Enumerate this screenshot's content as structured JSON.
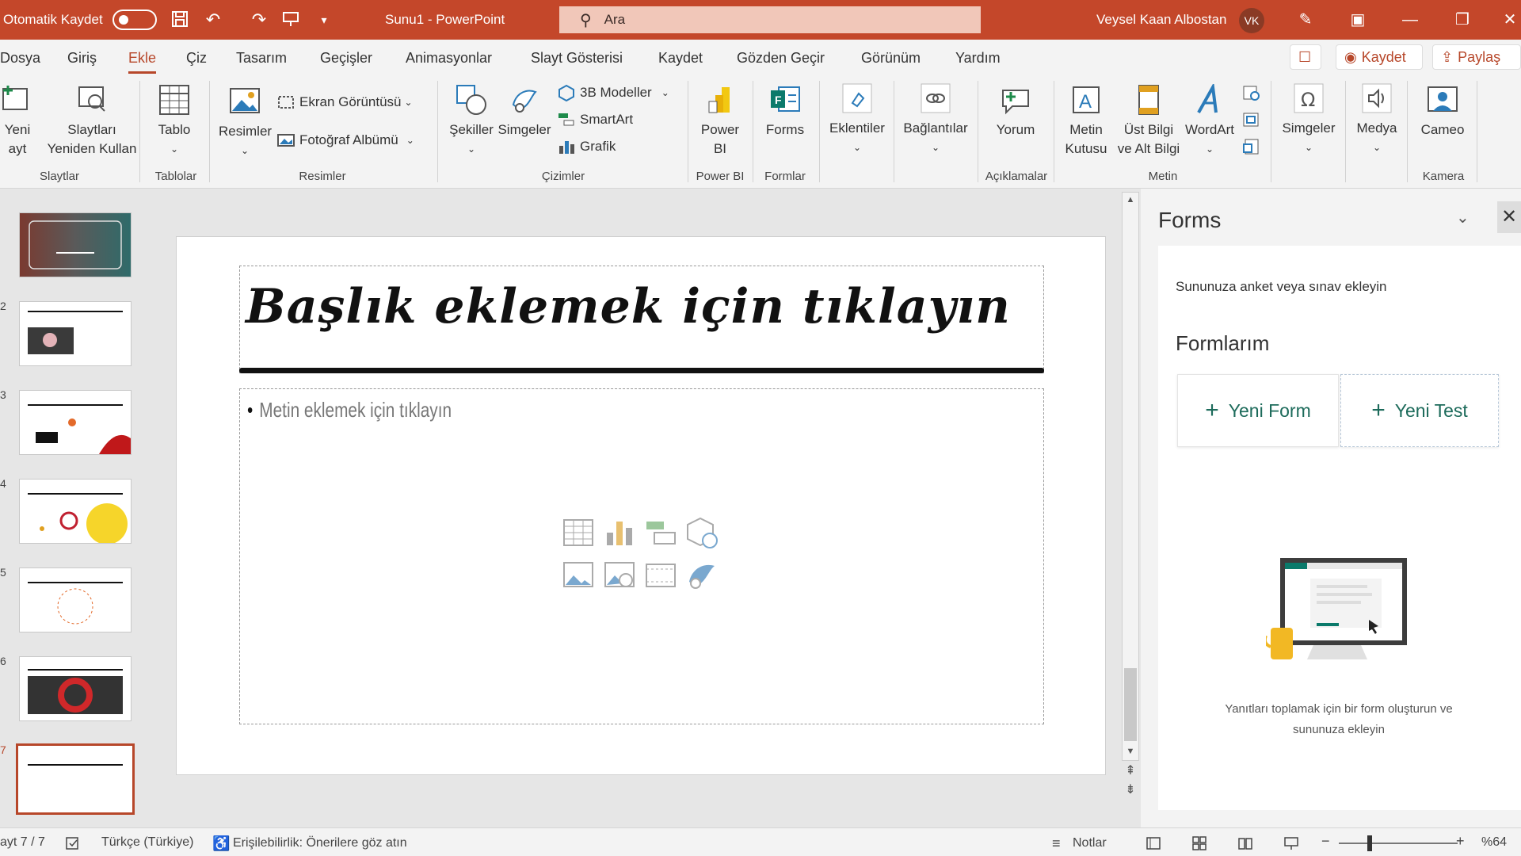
{
  "titlebar": {
    "autosave_label": "Otomatik Kaydet",
    "doc_title": "Sunu1  -  PowerPoint",
    "search_placeholder": "Ara",
    "username": "Veysel Kaan Albostan",
    "avatar_initials": "VK"
  },
  "menu": {
    "items": [
      "Dosya",
      "Giriş",
      "Ekle",
      "Çiz",
      "Tasarım",
      "Geçişler",
      "Animasyonlar",
      "Slayt Gösterisi",
      "Kaydet",
      "Gözden Geçir",
      "Görünüm",
      "Yardım"
    ],
    "active": "Ekle",
    "record_label": "Kaydet",
    "share_label": "Paylaş"
  },
  "ribbon": {
    "new_slide_1": "Yeni",
    "new_slide_2": "ayt",
    "reuse_1": "Slaytları",
    "reuse_2": "Yeniden Kullan",
    "table": "Tablo",
    "pictures": "Resimler",
    "screenshot": "Ekran Görüntüsü",
    "photo_album": "Fotoğraf Albümü",
    "shapes": "Şekiller",
    "icons": "Simgeler",
    "models3d": "3B Modeller",
    "smartart": "SmartArt",
    "chart": "Grafik",
    "powerbi_1": "Power",
    "powerbi_2": "BI",
    "forms": "Forms",
    "addins": "Eklentiler",
    "links": "Bağlantılar",
    "comment": "Yorum",
    "textbox_1": "Metin",
    "textbox_2": "Kutusu",
    "header_1": "Üst Bilgi",
    "header_2": "ve Alt Bilgi",
    "wordart": "WordArt",
    "symbols": "Simgeler",
    "media": "Medya",
    "cameo": "Cameo",
    "groups": {
      "slides": "Slaytlar",
      "tables": "Tablolar",
      "images": "Resimler",
      "drawings": "Çizimler",
      "powerbi": "Power BI",
      "forms": "Formlar",
      "comments": "Açıklamalar",
      "text": "Metin",
      "camera": "Kamera"
    }
  },
  "thumbnails": {
    "numbers": [
      "",
      "2",
      "3",
      "4",
      "5",
      "6",
      "7"
    ]
  },
  "slide": {
    "title_placeholder": "Başlık eklemek için tıklayın",
    "content_placeholder": "Metin eklemek için tıklayın"
  },
  "pane": {
    "title": "Forms",
    "subtitle": "Sununuza anket veya sınav ekleyin",
    "heading": "Formlarım",
    "new_form": "Yeni Form",
    "new_test": "Yeni Test",
    "footer": "Yanıtları toplamak için bir form oluşturun ve sununuza ekleyin"
  },
  "status": {
    "slide_count": "ayt 7 / 7",
    "language": "Türkçe (Türkiye)",
    "accessibility": "Erişilebilirlik: Önerilere göz atın",
    "notes": "Notlar",
    "zoom": "%64"
  },
  "colors": {
    "accent": "#c4472a",
    "teal": "#1d6b5b"
  }
}
